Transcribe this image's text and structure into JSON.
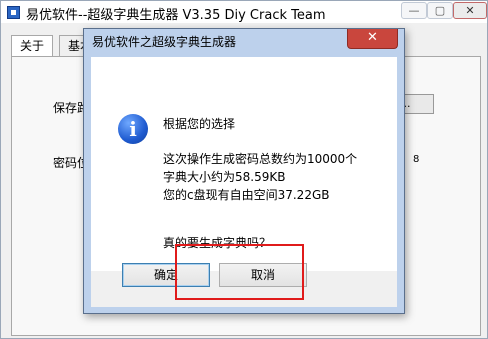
{
  "main_window": {
    "title": "易优软件--超级字典生成器 V3.35  Diy Crack Team",
    "controls": {
      "minimize": "—",
      "maximize": "▢",
      "close": "✕"
    },
    "tabs": [
      "关于",
      "基本"
    ],
    "save_label_partial": "保存路",
    "password_label_partial": "密码位",
    "browse_partial": "览...",
    "side_number": "8"
  },
  "dialog": {
    "title": "易优软件之超级字典生成器",
    "close": "✕",
    "icon": "info-icon",
    "lines": [
      "根据您的选择",
      "这次操作生成密码总数约为10000个",
      "字典大小约为58.59KB",
      "您的c盘现有自由空间37.22GB",
      "真的要生成字典吗？"
    ],
    "buttons": {
      "ok": "确定",
      "cancel": "取消"
    }
  },
  "colors": {
    "highlight": "#e01b1b",
    "dialog_frame": "#bdd1ec",
    "close_button": "#c9463d"
  }
}
